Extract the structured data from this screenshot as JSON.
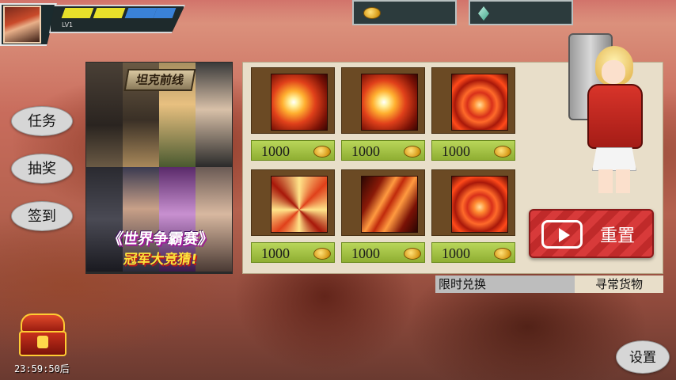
{
  "header": {
    "level_label": "LV1",
    "colors": {
      "energy": "#e8e12a",
      "mana": "#3a82d8"
    },
    "gold_icon": "gold-coin-icon",
    "gem_icon": "diamond-gem-icon"
  },
  "sidebar": {
    "task_label": "任务",
    "lottery_label": "抽奖",
    "checkin_label": "签到"
  },
  "banner": {
    "emblem_text": "坦克前线",
    "title": "《世界争霸赛》",
    "subtitle": "冠军大竞猜!"
  },
  "shop": {
    "items": [
      {
        "icon": "flame-swirl-skill-icon",
        "price": "1000"
      },
      {
        "icon": "fire-burst-skill-icon",
        "price": "1000"
      },
      {
        "icon": "vortex-skill-icon",
        "price": "1000"
      },
      {
        "icon": "lightning-skill-icon",
        "price": "1000"
      },
      {
        "icon": "flame-claw-skill-icon",
        "price": "1000"
      },
      {
        "icon": "vortex-skill-icon",
        "price": "1000"
      }
    ],
    "reset_label": "重置"
  },
  "tabs": {
    "limited_label": "限时兑换",
    "regular_label": "寻常货物"
  },
  "footer": {
    "timer": "23:59:50后",
    "settings_label": "设置"
  }
}
